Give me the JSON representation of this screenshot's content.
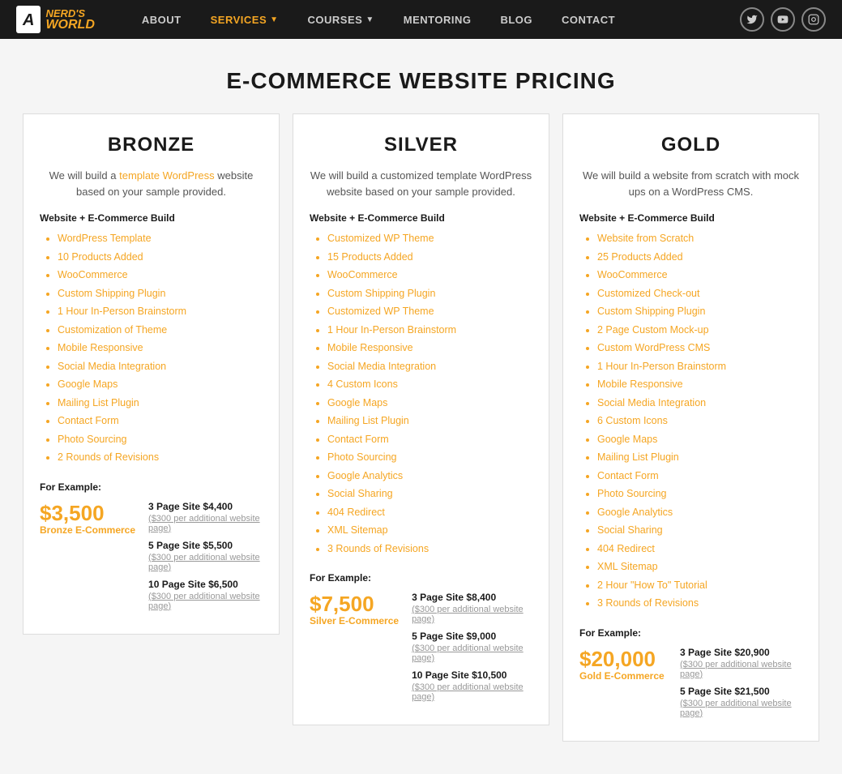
{
  "nav": {
    "logo_a": "A",
    "logo_nerds": "NERD'S",
    "logo_world": "WORLD",
    "links": [
      {
        "label": "ABOUT",
        "active": false
      },
      {
        "label": "SERVICES",
        "active": true,
        "arrow": true
      },
      {
        "label": "COURSES",
        "active": false,
        "arrow": true
      },
      {
        "label": "MENTORING",
        "active": false
      },
      {
        "label": "BLOG",
        "active": false
      },
      {
        "label": "CONTACT",
        "active": false
      }
    ],
    "social": [
      "𝕏",
      "▶",
      "📷"
    ]
  },
  "page": {
    "title": "E-COMMERCE WEBSITE PRICING"
  },
  "cards": [
    {
      "title": "BRONZE",
      "desc_parts": [
        "We will build a ",
        "template WordPress",
        " website based on your sample provided."
      ],
      "section_label": "Website + E-Commerce Build",
      "features": [
        "WordPress Template",
        "10 Products Added",
        "WooCommerce",
        "Custom Shipping Plugin",
        "1 Hour In-Person Brainstorm",
        "Customization of Theme",
        "Mobile Responsive",
        "Social Media Integration",
        "Google Maps",
        "Mailing List Plugin",
        "Contact Form",
        "Photo Sourcing",
        "2 Rounds of Revisions"
      ],
      "for_example": "For Example:",
      "big_price": "$3,500",
      "price_label": "Bronze E-Commerce",
      "tiers": [
        {
          "label": "3 Page Site $4,400",
          "note": "($300 per additional website page)"
        },
        {
          "label": "5 Page Site $5,500",
          "note": "($300 per additional website page)"
        },
        {
          "label": "10 Page Site $6,500",
          "note": "($300 per additional website page)"
        }
      ]
    },
    {
      "title": "SILVER",
      "desc_parts": [
        "We will build a customized template WordPress website based on your sample provided."
      ],
      "section_label": "Website + E-Commerce Build",
      "features": [
        "Customized WP Theme",
        "15 Products Added",
        "WooCommerce",
        "Custom Shipping Plugin",
        "Customized WP Theme",
        "1 Hour In-Person Brainstorm",
        "Mobile Responsive",
        "Social Media Integration",
        "4 Custom Icons",
        "Google Maps",
        "Mailing List Plugin",
        "Contact Form",
        "Photo Sourcing",
        "Google Analytics",
        "Social Sharing",
        "404 Redirect",
        "XML Sitemap",
        "3 Rounds of Revisions"
      ],
      "for_example": "For Example:",
      "big_price": "$7,500",
      "price_label": "Silver E-Commerce",
      "tiers": [
        {
          "label": "3 Page Site $8,400",
          "note": "($300 per additional website page)"
        },
        {
          "label": "5 Page Site $9,000",
          "note": "($300 per additional website page)"
        },
        {
          "label": "10 Page Site $10,500",
          "note": "($300 per additional website page)"
        }
      ]
    },
    {
      "title": "GOLD",
      "desc_parts": [
        "We will build a website from scratch with mock ups on a WordPress CMS."
      ],
      "section_label": "Website + E-Commerce Build",
      "features": [
        "Website from Scratch",
        "25 Products Added",
        "WooCommerce",
        "Customized Check-out",
        "Custom Shipping Plugin",
        "2 Page Custom Mock-up",
        "Custom WordPress CMS",
        "1 Hour In-Person Brainstorm",
        "Mobile Responsive",
        "Social Media Integration",
        "6 Custom Icons",
        "Google Maps",
        "Mailing List Plugin",
        "Contact Form",
        "Photo Sourcing",
        "Google Analytics",
        "Social Sharing",
        "404 Redirect",
        "XML Sitemap",
        "2 Hour \"How To\" Tutorial",
        "3 Rounds of Revisions"
      ],
      "for_example": "For Example:",
      "big_price": "$20,000",
      "price_label": "Gold E-Commerce",
      "tiers": [
        {
          "label": "3 Page Site $20,900",
          "note": "($300 per additional website page)"
        },
        {
          "label": "5 Page Site $21,500",
          "note": "($300 per additional website page)"
        }
      ]
    }
  ]
}
